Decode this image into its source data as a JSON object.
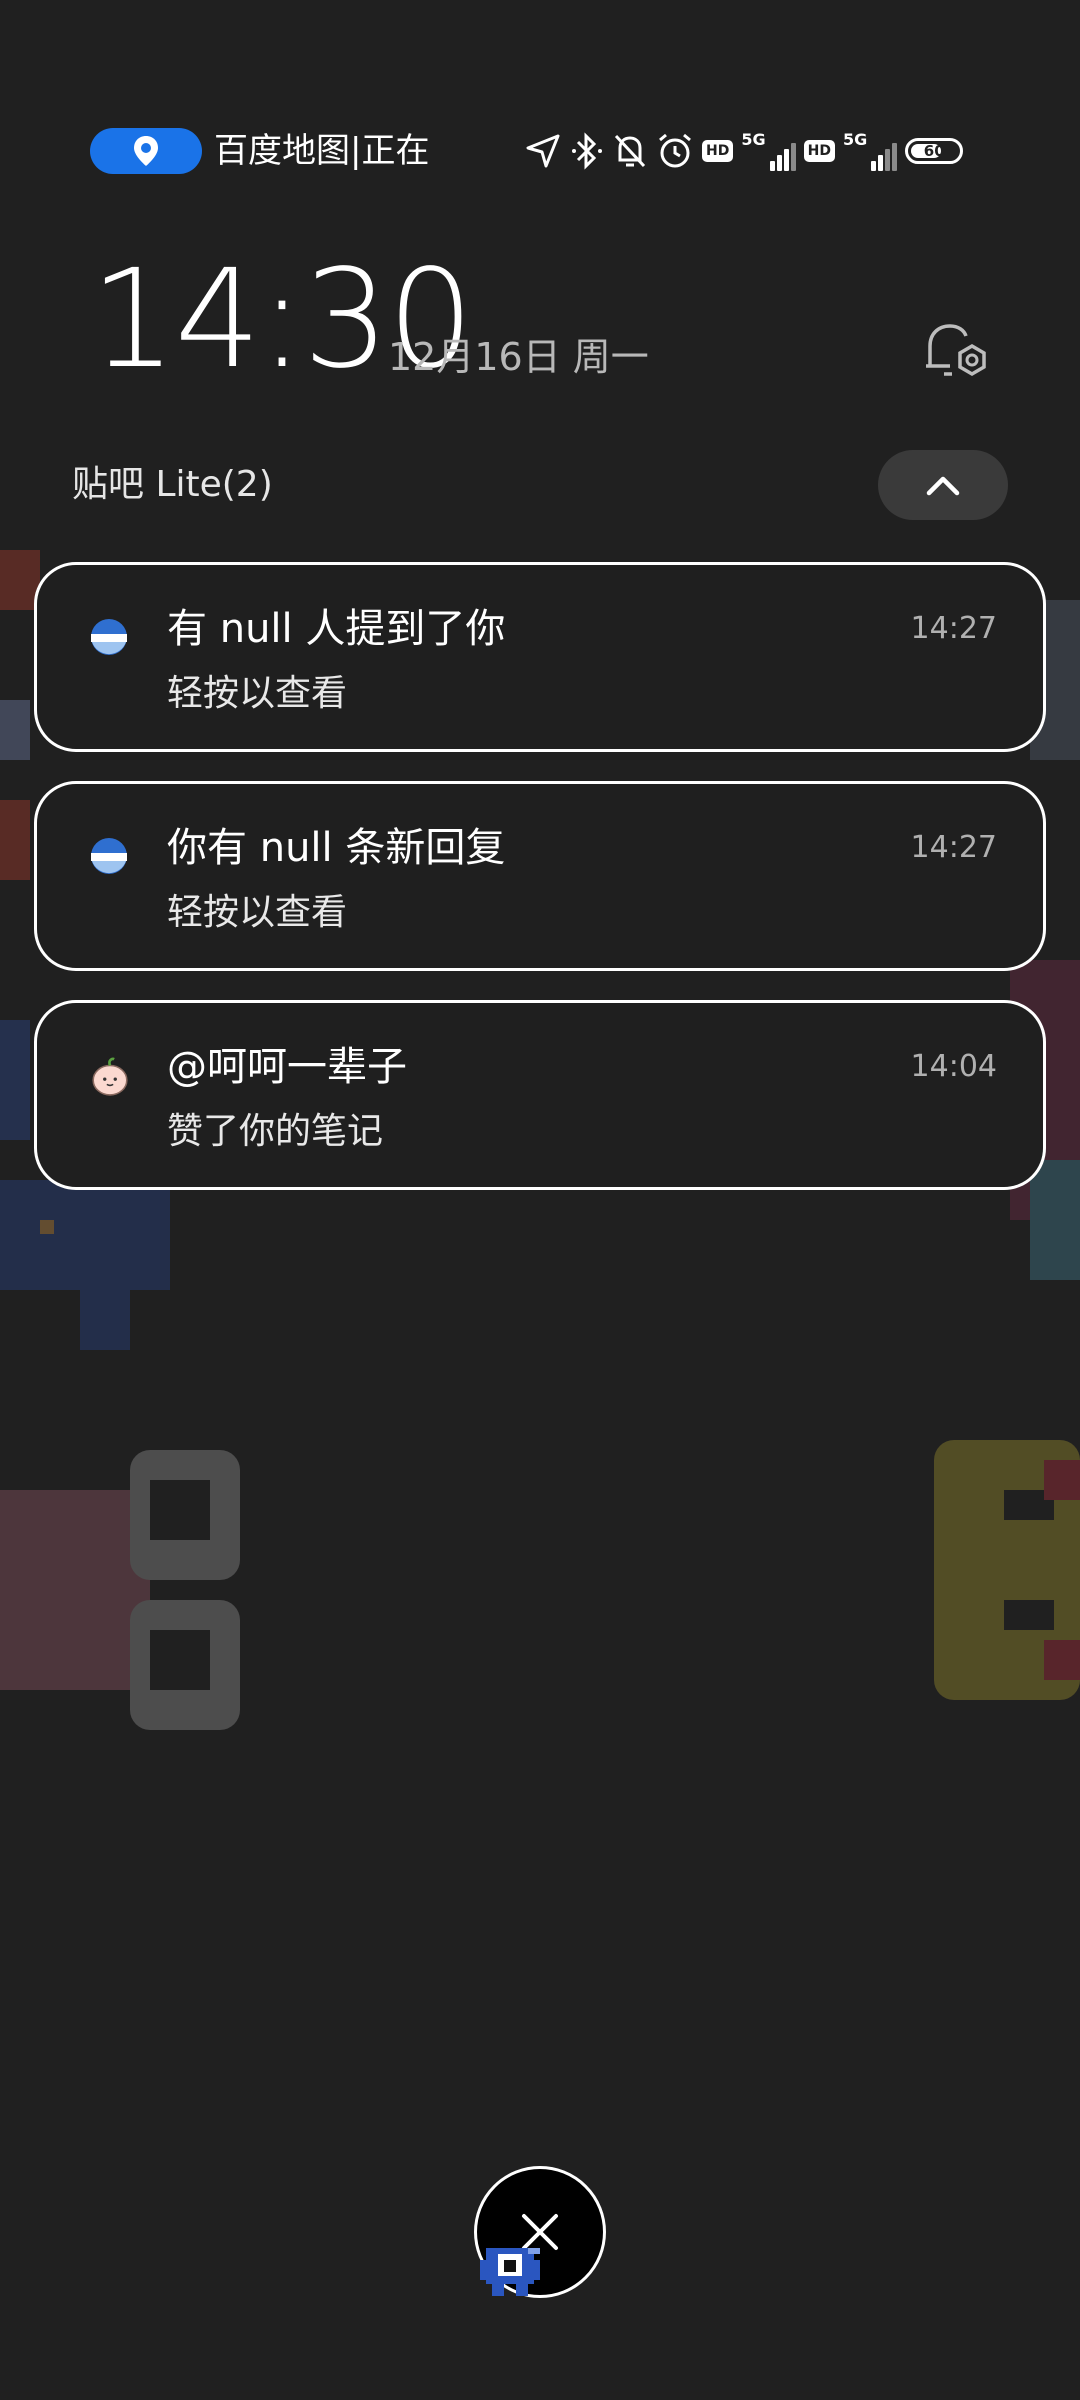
{
  "status_bar": {
    "location_icon": "location-pin-icon",
    "location_text": "百度地图|正在",
    "icons": [
      "navigation-arrow-icon",
      "bluetooth-icon",
      "bell-muted-icon",
      "alarm-icon",
      "hd-icon",
      "signal-5g-icon",
      "hd-icon",
      "signal-5g-icon",
      "battery-icon"
    ],
    "hd_label": "HD",
    "network_label": "5G",
    "battery_level": "60",
    "accent_color": "#1a73e8"
  },
  "lockscreen": {
    "time": "14:30",
    "date": "12月16日 周一",
    "settings_icon": "notification-settings-icon"
  },
  "group": {
    "title": "贴吧 Lite(2)",
    "collapse_icon": "chevron-up-icon"
  },
  "notifications": [
    {
      "icon": "tieba-lite-icon",
      "title": "有 null 人提到了你",
      "body": "轻按以查看",
      "time": "14:27"
    },
    {
      "icon": "tieba-lite-icon",
      "title": "你有 null 条新回复",
      "body": "轻按以查看",
      "time": "14:27"
    },
    {
      "icon": "peach-avatar-icon",
      "title": "@呵呵一辈子",
      "body": "赞了你的笔记",
      "time": "14:04"
    }
  ],
  "close_button": {
    "icon": "close-icon"
  }
}
